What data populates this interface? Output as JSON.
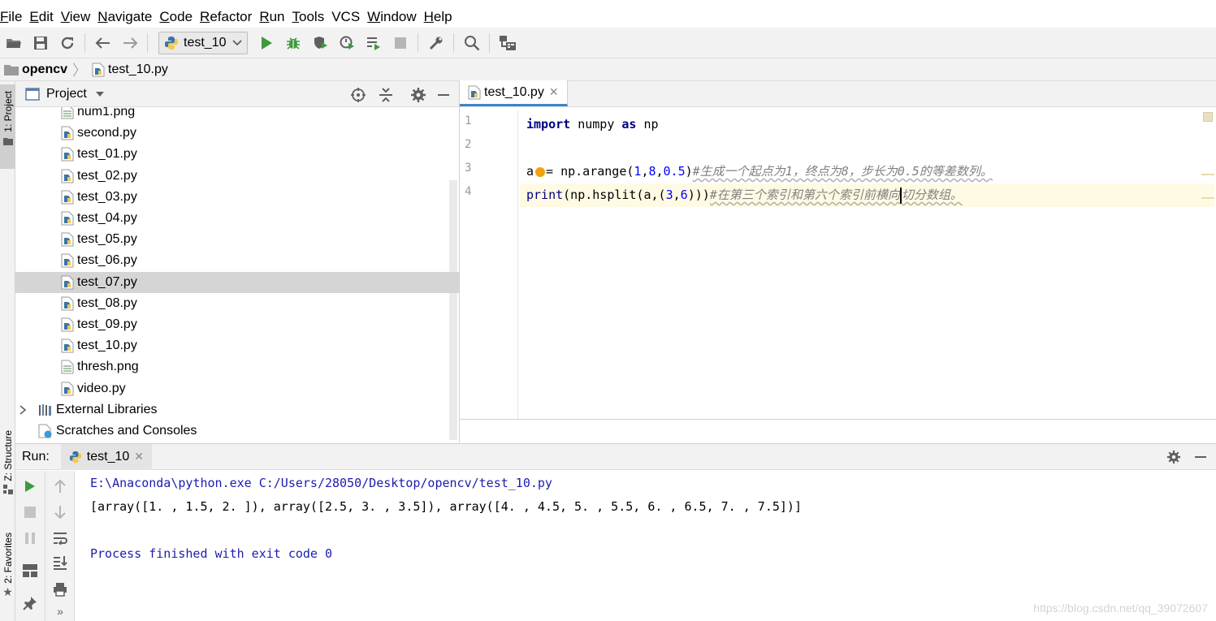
{
  "menubar": {
    "items": [
      {
        "label": "File",
        "u": "F",
        "rest": "ile"
      },
      {
        "label": "Edit",
        "u": "E",
        "rest": "dit"
      },
      {
        "label": "View",
        "u": "V",
        "rest": "iew"
      },
      {
        "label": "Navigate",
        "u": "N",
        "rest": "avigate"
      },
      {
        "label": "Code",
        "u": "C",
        "rest": "ode"
      },
      {
        "label": "Refactor",
        "u": "R",
        "rest": "efactor"
      },
      {
        "label": "Run",
        "u": "R",
        "rest": "un",
        "uIndex": 1
      },
      {
        "label": "Tools",
        "u": "T",
        "rest": "ools"
      },
      {
        "label": "VCS",
        "u": "",
        "rest": "VCS"
      },
      {
        "label": "Window",
        "u": "W",
        "rest": "indow"
      },
      {
        "label": "Help",
        "u": "H",
        "rest": "elp"
      }
    ]
  },
  "toolbar": {
    "run_config": "test_10",
    "icons": [
      "open-folder-icon",
      "save-icon",
      "sync-icon",
      "back-arrow-icon",
      "forward-arrow-icon",
      "run-icon",
      "debug-icon",
      "coverage-icon",
      "profile-icon",
      "concurrency-icon",
      "stop-icon",
      "settings-wrench-icon",
      "search-icon",
      "project-structure-icon"
    ]
  },
  "navbar": {
    "project": "opencv",
    "file": "test_10.py"
  },
  "left_strip": {
    "project_tab": "1: Project",
    "structure_tab": "Z: Structure",
    "favorites_tab": "2: Favorites"
  },
  "project_panel": {
    "title": "Project",
    "files": [
      {
        "name": "num1.png",
        "type": "image"
      },
      {
        "name": "second.py",
        "type": "python"
      },
      {
        "name": "test_01.py",
        "type": "python"
      },
      {
        "name": "test_02.py",
        "type": "python"
      },
      {
        "name": "test_03.py",
        "type": "python"
      },
      {
        "name": "test_04.py",
        "type": "python"
      },
      {
        "name": "test_05.py",
        "type": "python"
      },
      {
        "name": "test_06.py",
        "type": "python"
      },
      {
        "name": "test_07.py",
        "type": "python",
        "selected": true
      },
      {
        "name": "test_08.py",
        "type": "python"
      },
      {
        "name": "test_09.py",
        "type": "python"
      },
      {
        "name": "test_10.py",
        "type": "python"
      },
      {
        "name": "thresh.png",
        "type": "image"
      },
      {
        "name": "video.py",
        "type": "python"
      }
    ],
    "external_libraries": "External Libraries",
    "scratches": "Scratches and Consoles"
  },
  "editor": {
    "tab_label": "test_10.py",
    "line_numbers": [
      "1",
      "2",
      "3",
      "4"
    ],
    "code": {
      "l1_import": "import",
      "l1_mod": " numpy ",
      "l1_as": "as",
      "l1_alias": " np",
      "l3_var": "a",
      "l3_rest_a": "= np.arange(",
      "l3_n1": "1",
      "l3_c1": ",",
      "l3_n2": "8",
      "l3_c2": ",",
      "l3_n3": "0.5",
      "l3_close": ")",
      "l3_comment": "#生成一个起点为1，终点为8，步长为0.5的等差数列。",
      "l4_print": "print",
      "l4_rest_a": "(np.hsplit(a,(",
      "l4_n1": "3",
      "l4_c1": ",",
      "l4_n2": "6",
      "l4_close": ")))",
      "l4_comment_a": "#在第三个索引和第六个索引前横向",
      "l4_comment_b": "切分数组。"
    }
  },
  "run_panel": {
    "label": "Run:",
    "tab_label": "test_10",
    "console": {
      "command": "E:\\Anaconda\\python.exe C:/Users/28050/Desktop/opencv/test_10.py",
      "output": "[array([1. , 1.5, 2. ]), array([2.5, 3. , 3.5]), array([4. , 4.5, 5. , 5.5, 6. , 6.5, 7. , 7.5])]",
      "finished": "Process finished with exit code 0"
    }
  },
  "watermark": "https://blog.csdn.net/qq_39072607",
  "colors": {
    "keyword": "#000080",
    "number": "#0000ff",
    "comment": "#808080",
    "run_green": "#3d9a3d",
    "selection": "#d5d5d5",
    "current_line": "#fffae3"
  }
}
